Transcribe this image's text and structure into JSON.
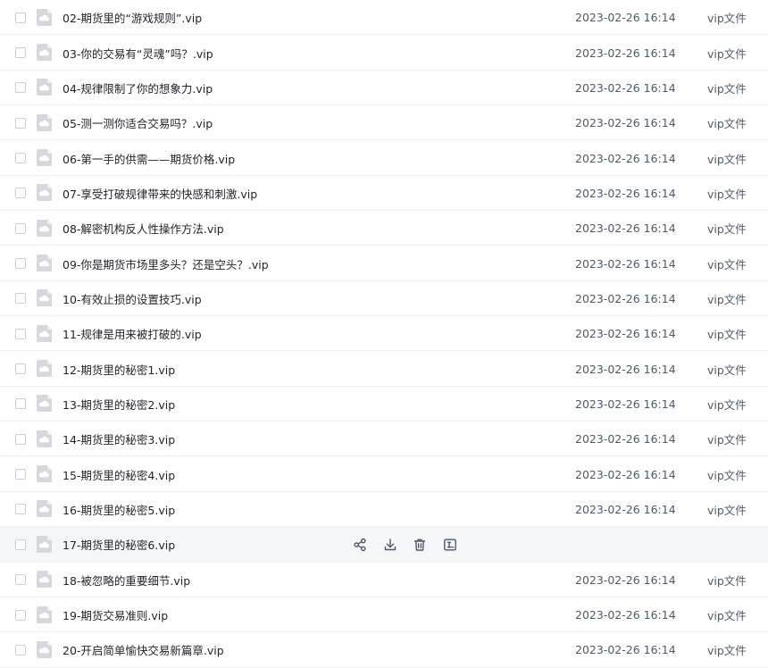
{
  "files": [
    {
      "name": "02-期货里的“游戏规则”.vip",
      "date": "2023-02-26 16:14",
      "type": "vip文件"
    },
    {
      "name": "03-你的交易有“灵魂”吗？.vip",
      "date": "2023-02-26 16:14",
      "type": "vip文件"
    },
    {
      "name": "04-规律限制了你的想象力.vip",
      "date": "2023-02-26 16:14",
      "type": "vip文件"
    },
    {
      "name": "05-测一测你适合交易吗？.vip",
      "date": "2023-02-26 16:14",
      "type": "vip文件"
    },
    {
      "name": "06-第一手的供需——期货价格.vip",
      "date": "2023-02-26 16:14",
      "type": "vip文件"
    },
    {
      "name": "07-享受打破规律带来的快感和刺激.vip",
      "date": "2023-02-26 16:14",
      "type": "vip文件"
    },
    {
      "name": "08-解密机构反人性操作方法.vip",
      "date": "2023-02-26 16:14",
      "type": "vip文件"
    },
    {
      "name": "09-你是期货市场里多头？还是空头？.vip",
      "date": "2023-02-26 16:14",
      "type": "vip文件"
    },
    {
      "name": "10-有效止损的设置技巧.vip",
      "date": "2023-02-26 16:14",
      "type": "vip文件"
    },
    {
      "name": "11-规律是用来被打破的.vip",
      "date": "2023-02-26 16:14",
      "type": "vip文件"
    },
    {
      "name": "12-期货里的秘密1.vip",
      "date": "2023-02-26 16:14",
      "type": "vip文件"
    },
    {
      "name": "13-期货里的秘密2.vip",
      "date": "2023-02-26 16:14",
      "type": "vip文件"
    },
    {
      "name": "14-期货里的秘密3.vip",
      "date": "2023-02-26 16:14",
      "type": "vip文件"
    },
    {
      "name": "15-期货里的秘密4.vip",
      "date": "2023-02-26 16:14",
      "type": "vip文件"
    },
    {
      "name": "16-期货里的秘密5.vip",
      "date": "2023-02-26 16:14",
      "type": "vip文件"
    },
    {
      "name": "17-期货里的秘密6.vip",
      "date": "",
      "type": "",
      "hovered": true
    },
    {
      "name": "18-被忽略的重要细节.vip",
      "date": "2023-02-26 16:14",
      "type": "vip文件"
    },
    {
      "name": "19-期货交易准则.vip",
      "date": "2023-02-26 16:14",
      "type": "vip文件"
    },
    {
      "name": "20-开启简单愉快交易新篇章.vip",
      "date": "2023-02-26 16:14",
      "type": "vip文件"
    }
  ],
  "hover_actions": [
    {
      "icon": "share-icon"
    },
    {
      "icon": "download-icon"
    },
    {
      "icon": "delete-icon"
    },
    {
      "icon": "rename-icon"
    }
  ],
  "colors": {
    "icon_gray": "#c8ccd3",
    "action_icon": "#4e5969",
    "hover_row_bg": "#f5f6f8"
  }
}
